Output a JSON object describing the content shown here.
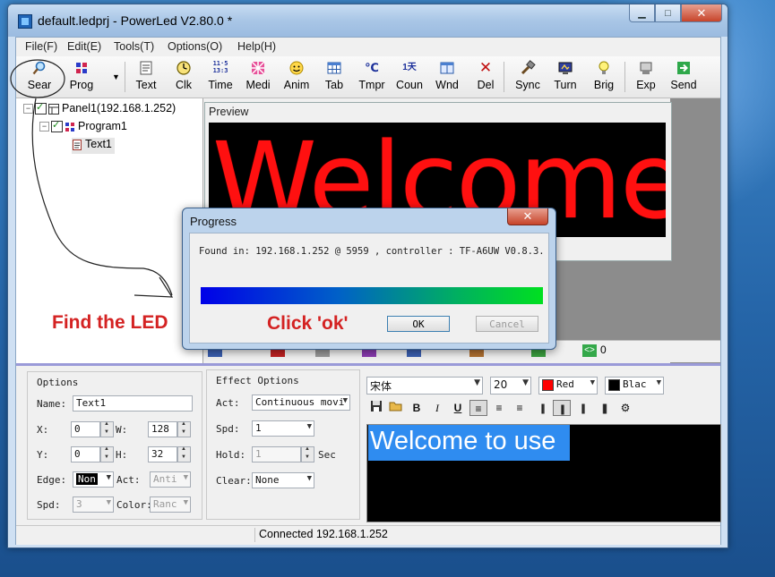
{
  "window": {
    "title": "default.ledprj - PowerLed V2.80.0 *",
    "min": "▁",
    "max": "□",
    "close": "✕"
  },
  "menu": [
    "File(F)",
    "Edit(E)",
    "Tools(T)",
    "Options(O)",
    "Help(H)"
  ],
  "toolbar": [
    {
      "label": "Sear",
      "icon": "search-icon"
    },
    {
      "label": "Prog",
      "icon": "program-icon"
    },
    {
      "label": "Text",
      "icon": "text-icon"
    },
    {
      "label": "Clk",
      "icon": "clock-icon"
    },
    {
      "label": "Time",
      "icon": "time-icon"
    },
    {
      "label": "Medi",
      "icon": "media-icon"
    },
    {
      "label": "Anim",
      "icon": "animation-icon"
    },
    {
      "label": "Tab",
      "icon": "table-icon"
    },
    {
      "label": "Tmpr",
      "icon": "temperature-icon"
    },
    {
      "label": "Coun",
      "icon": "counter-icon"
    },
    {
      "label": "Wnd",
      "icon": "window-icon"
    },
    {
      "label": "Del",
      "icon": "delete-icon"
    },
    {
      "label": "Sync",
      "icon": "sync-icon"
    },
    {
      "label": "Turn",
      "icon": "turn-icon"
    },
    {
      "label": "Brig",
      "icon": "brightness-icon"
    },
    {
      "label": "Exp",
      "icon": "export-icon"
    },
    {
      "label": "Send",
      "icon": "send-icon"
    }
  ],
  "toolbar_icons": {
    "time_top": "11·5",
    "time_bottom": "13:3",
    "counter": "1天"
  },
  "tree": {
    "panel": "Panel1(192.168.1.252)",
    "program": "Program1",
    "text": "Text1"
  },
  "preview": {
    "title": "Preview",
    "led_text": "Welcome"
  },
  "strip": {
    "count": "0"
  },
  "options": {
    "title": "Options",
    "name_label": "Name:",
    "name_value": "Text1",
    "x_label": "X:",
    "x_value": "0",
    "w_label": "W:",
    "w_value": "128",
    "y_label": "Y:",
    "y_value": "0",
    "h_label": "H:",
    "h_value": "32",
    "edge_label": "Edge:",
    "edge_value": "Non",
    "act_label": "Act:",
    "act_value": "Anti",
    "spd_label": "Spd:",
    "spd_value": "3",
    "color_label": "Color:",
    "color_value": "Ranc"
  },
  "effect": {
    "title": "Effect Options",
    "act_label": "Act:",
    "act_value": "Continuous movi",
    "spd_label": "Spd:",
    "spd_value": "1",
    "hold_label": "Hold:",
    "hold_value": "1",
    "hold_unit": "Sec",
    "clear_label": "Clear:",
    "clear_value": "None"
  },
  "editor": {
    "font": "宋体",
    "size": "20",
    "fg_color": "Red",
    "bg_color": "Blac",
    "fg_hex": "#ff0000",
    "bg_hex": "#000000",
    "content": "Welcome to use",
    "buttons": [
      "B",
      "I",
      "U"
    ]
  },
  "status": {
    "text": "Connected 192.168.1.252"
  },
  "dialog": {
    "title": "Progress",
    "message": "Found in: 192.168.1.252 @ 5959 , controller : TF-A6UW V0.8.3.",
    "ok": "OK",
    "cancel": "Cancel"
  },
  "annotations": {
    "find": "Find the LED",
    "click": "Click 'ok'"
  }
}
